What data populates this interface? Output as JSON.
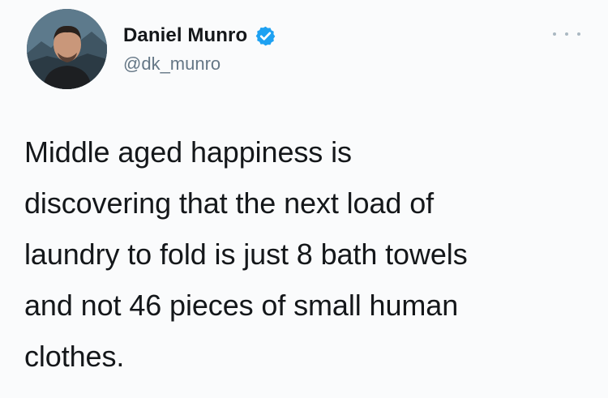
{
  "author": {
    "display_name": "Daniel Munro",
    "handle": "@dk_munro",
    "verified": true,
    "verified_color": "#1da1f2"
  },
  "tweet": {
    "text": "Middle aged happiness is\ndiscovering that the next load of\nlaundry to fold is just 8 bath towels\nand not 46 pieces of small human\nclothes."
  },
  "icons": {
    "verified": "verified-badge-icon",
    "more": "more-options-icon"
  }
}
